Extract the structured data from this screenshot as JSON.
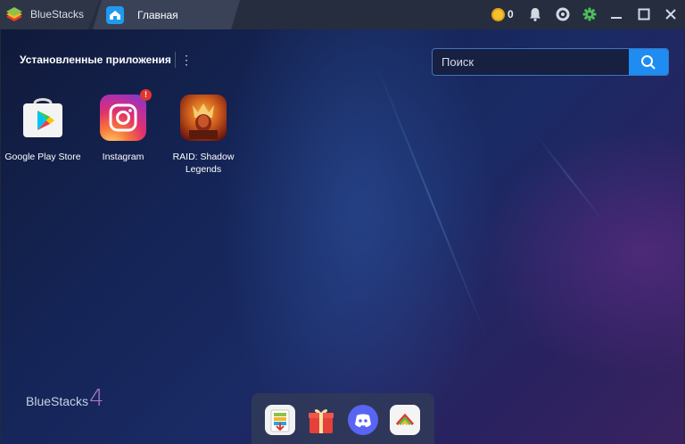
{
  "titlebar": {
    "app_tab_label": "BlueStacks",
    "home_tab_label": "Главная",
    "coin_count": "0",
    "icons": [
      "coin-icon",
      "bell-icon",
      "account-icon",
      "settings-gear-icon",
      "minimize-icon",
      "maximize-icon",
      "close-icon"
    ]
  },
  "main": {
    "section_title": "Установленные приложения",
    "menu_glyph": "⋮",
    "search": {
      "placeholder": "Поиск",
      "value": ""
    },
    "apps": [
      {
        "label": "Google Play Store",
        "icon": "google-play-store-icon"
      },
      {
        "label": "Instagram",
        "icon": "instagram-icon",
        "badge": "!"
      },
      {
        "label": "RAID: Shadow Legends",
        "icon": "raid-shadow-legends-icon"
      }
    ],
    "watermark": {
      "text": "BlueStacks",
      "version": "4"
    },
    "dock": [
      "app-center-icon",
      "gift-icon",
      "discord-icon",
      "camo-icon"
    ]
  },
  "colors": {
    "accent": "#1e8cf0",
    "titlebar": "#262d3f",
    "badge": "#e2352f"
  }
}
